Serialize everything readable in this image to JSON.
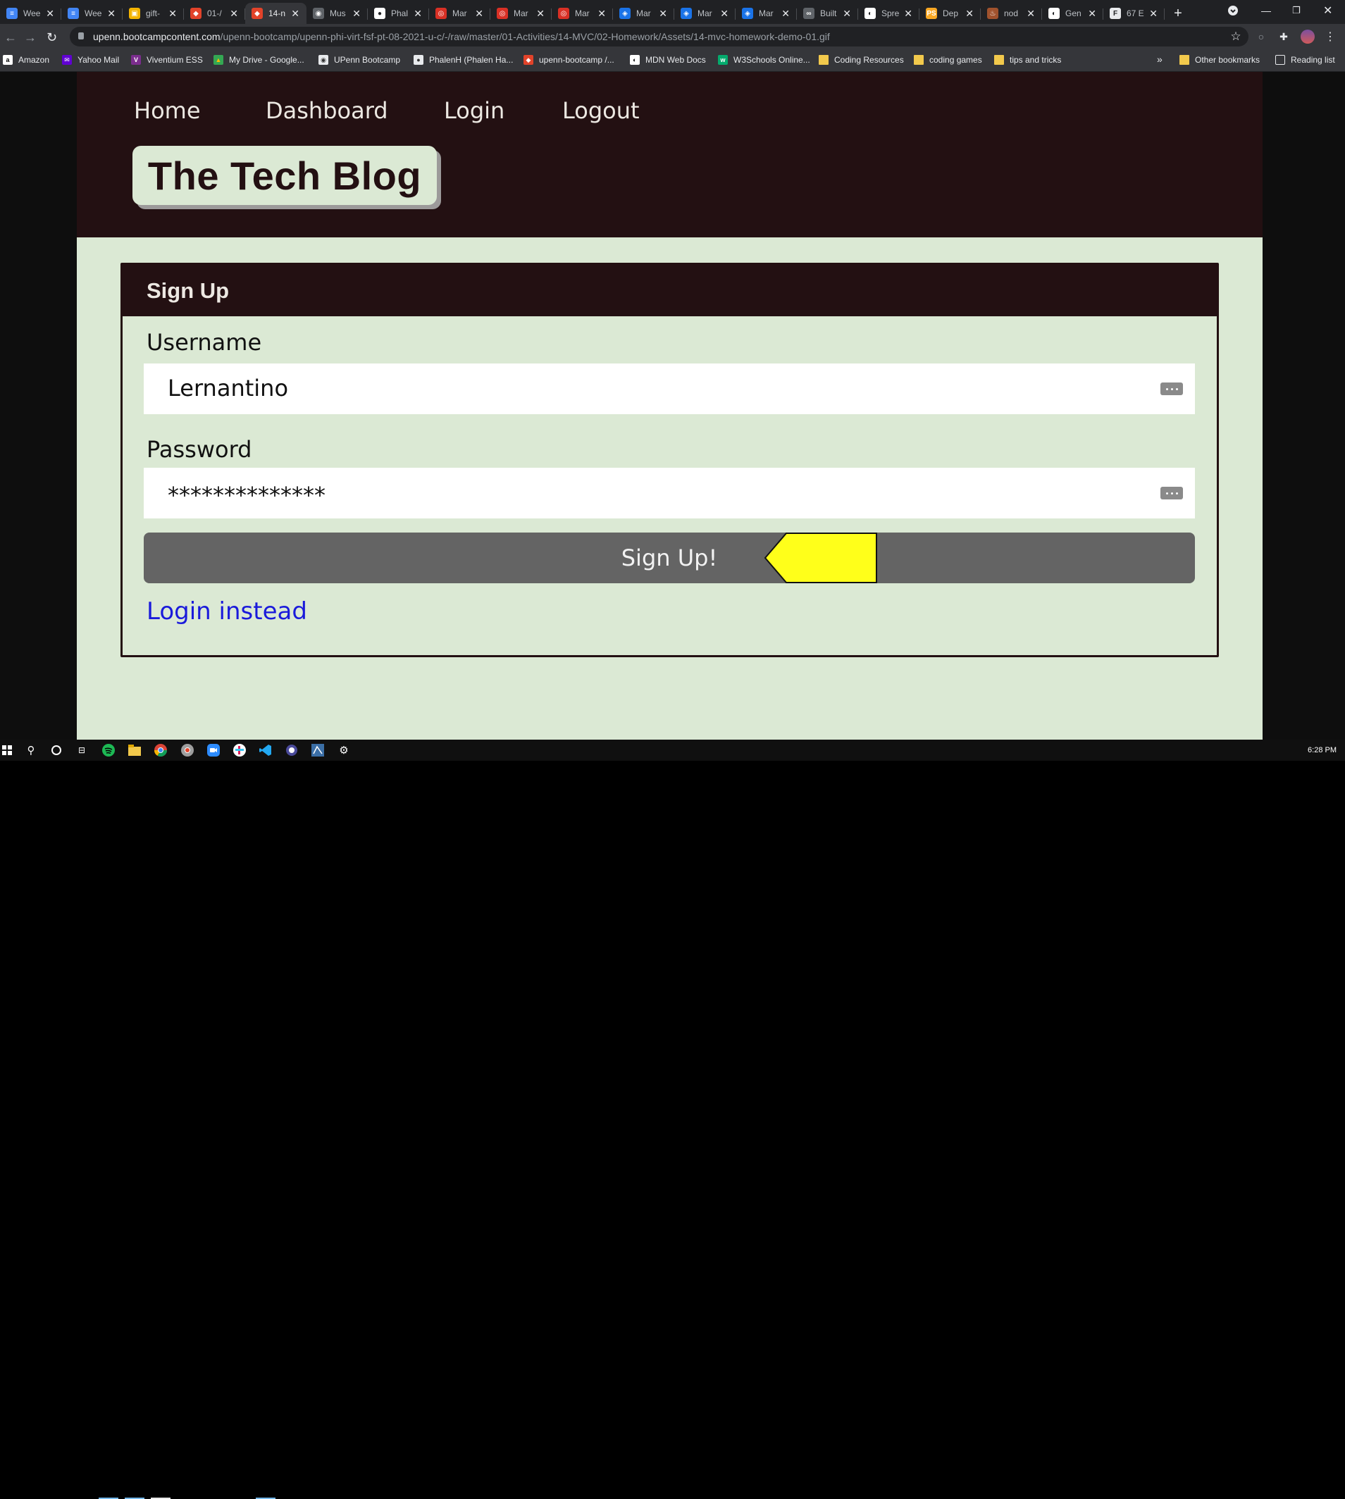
{
  "browser": {
    "tabs": [
      {
        "title": "Wee",
        "fav_color": "#4285f4",
        "fav_glyph": "≡"
      },
      {
        "title": "Wee",
        "fav_color": "#4285f4",
        "fav_glyph": "≡"
      },
      {
        "title": "gift-",
        "fav_color": "#f4b400",
        "fav_glyph": "▣"
      },
      {
        "title": "01-/",
        "fav_color": "#e2432a",
        "fav_glyph": "◆"
      },
      {
        "title": "14-n",
        "fav_color": "#e2432a",
        "fav_glyph": "◆",
        "active": true
      },
      {
        "title": "Mus",
        "fav_color": "#5f6368",
        "fav_glyph": "◉"
      },
      {
        "title": "Phal",
        "fav_color": "#ffffff",
        "fav_glyph": "●"
      },
      {
        "title": "Mar",
        "fav_color": "#d93025",
        "fav_glyph": "◎"
      },
      {
        "title": "Mar",
        "fav_color": "#d93025",
        "fav_glyph": "◎"
      },
      {
        "title": "Mar",
        "fav_color": "#d93025",
        "fav_glyph": "◎"
      },
      {
        "title": "Mar",
        "fav_color": "#1a73e8",
        "fav_glyph": "◈"
      },
      {
        "title": "Mar",
        "fav_color": "#1a73e8",
        "fav_glyph": "◈"
      },
      {
        "title": "Mar",
        "fav_color": "#1a73e8",
        "fav_glyph": "◈"
      },
      {
        "title": "Built",
        "fav_color": "#5f6368",
        "fav_glyph": "∞"
      },
      {
        "title": "Spre",
        "fav_color": "#ffffff",
        "fav_glyph": "◐"
      },
      {
        "title": "Dep",
        "fav_color": "#f9a825",
        "fav_glyph": "PS"
      },
      {
        "title": "nod",
        "fav_color": "#a0522d",
        "fav_glyph": "♨"
      },
      {
        "title": "Gen",
        "fav_color": "#ffffff",
        "fav_glyph": "◐"
      },
      {
        "title": "67 E",
        "fav_color": "#e8eaed",
        "fav_glyph": "F"
      }
    ],
    "url_host": "upenn.bootcampcontent.com",
    "url_path": "/upenn-bootcamp/upenn-phi-virt-fsf-pt-08-2021-u-c/-/raw/master/01-Activities/14-MVC/02-Homework/Assets/14-mvc-homework-demo-01.gif",
    "bookmarks": [
      {
        "label": "Amazon",
        "color": "#ffffff",
        "glyph": "a",
        "fg": "#000"
      },
      {
        "label": "Yahoo Mail",
        "color": "#6001d2",
        "glyph": "✉",
        "fg": "#fff"
      },
      {
        "label": "Viventium ESS",
        "color": "#7b2d8e",
        "glyph": "V",
        "fg": "#fff"
      },
      {
        "label": "My Drive - Google...",
        "color": "#34a853",
        "glyph": "▲",
        "fg": "#fbbc04"
      },
      {
        "label": "UPenn Bootcamp",
        "color": "#e8eaed",
        "glyph": "◉",
        "fg": "#333"
      },
      {
        "label": "PhalenH (Phalen Ha...",
        "color": "#e8eaed",
        "glyph": "●",
        "fg": "#333"
      },
      {
        "label": "upenn-bootcamp /...",
        "color": "#e2432a",
        "glyph": "◆",
        "fg": "#fff"
      },
      {
        "label": "MDN Web Docs",
        "color": "#ffffff",
        "glyph": "◐",
        "fg": "#000"
      },
      {
        "label": "W3Schools Online...",
        "color": "#04aa6d",
        "glyph": "w",
        "fg": "#fff"
      },
      {
        "label": "Coding Resources",
        "folder": true
      },
      {
        "label": "coding games",
        "folder": true
      },
      {
        "label": "tips and tricks",
        "folder": true
      }
    ],
    "bookmarks_overflow": "»",
    "other_bookmarks": "Other bookmarks",
    "reading_list": "Reading list"
  },
  "site": {
    "nav": [
      "Home",
      "Dashboard",
      "Login",
      "Logout"
    ],
    "brand": "The Tech Blog",
    "form": {
      "title": "Sign Up",
      "username_label": "Username",
      "username_value": "Lernantino",
      "password_label": "Password",
      "password_value": "**************",
      "submit_label": "Sign Up!",
      "alt_link": "Login instead"
    },
    "colors": {
      "header_bg": "#231012",
      "page_bg": "#dbe9d4",
      "button_bg": "#646464",
      "link": "#1a1adb",
      "pointer": "#ffff1a"
    }
  },
  "taskbar": {
    "clock": "6:28 PM"
  }
}
